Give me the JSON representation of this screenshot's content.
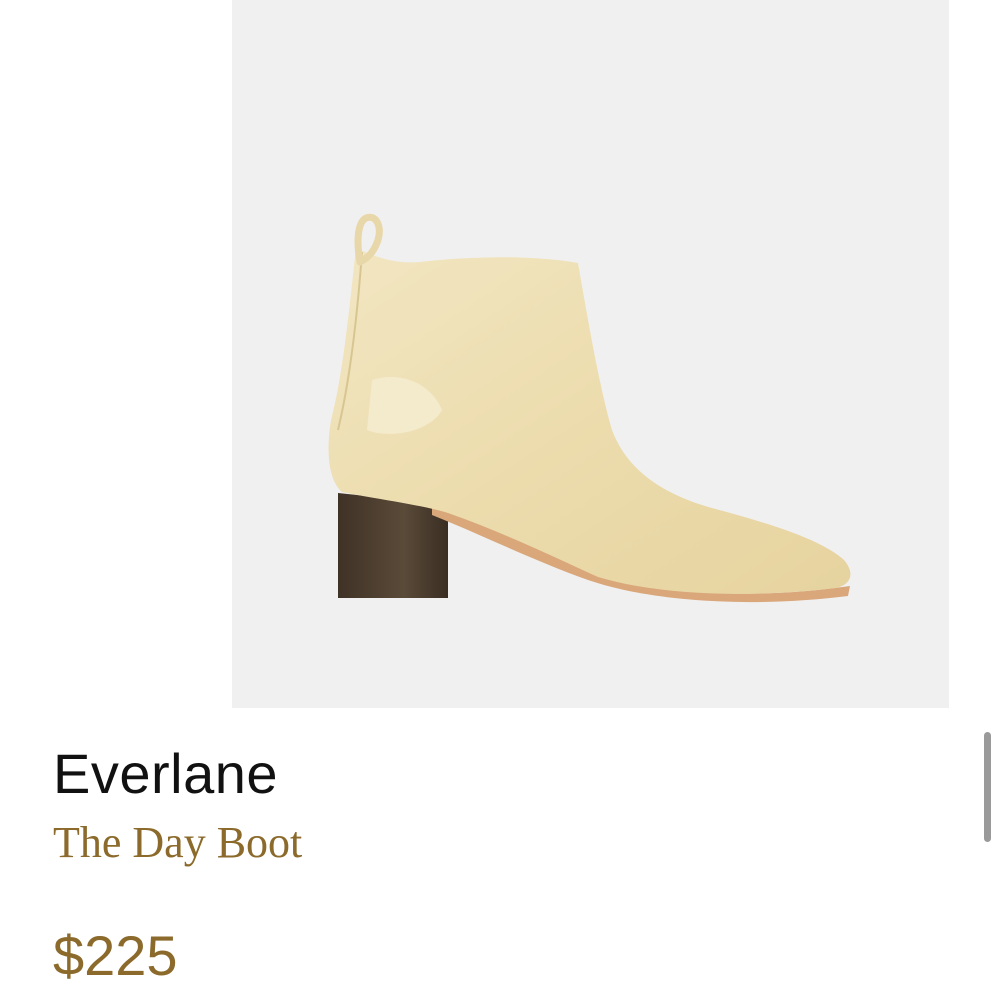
{
  "product": {
    "brand": "Everlane",
    "name": "The Day Boot",
    "price": "$225"
  },
  "image": {
    "subject": "boot-image",
    "background_color": "#f1f0f1",
    "boot_color": "#efe1b7",
    "heel_color": "#4a3c2e"
  },
  "colors": {
    "brand_text": "#111111",
    "accent_gold": "#8b6a2c"
  }
}
